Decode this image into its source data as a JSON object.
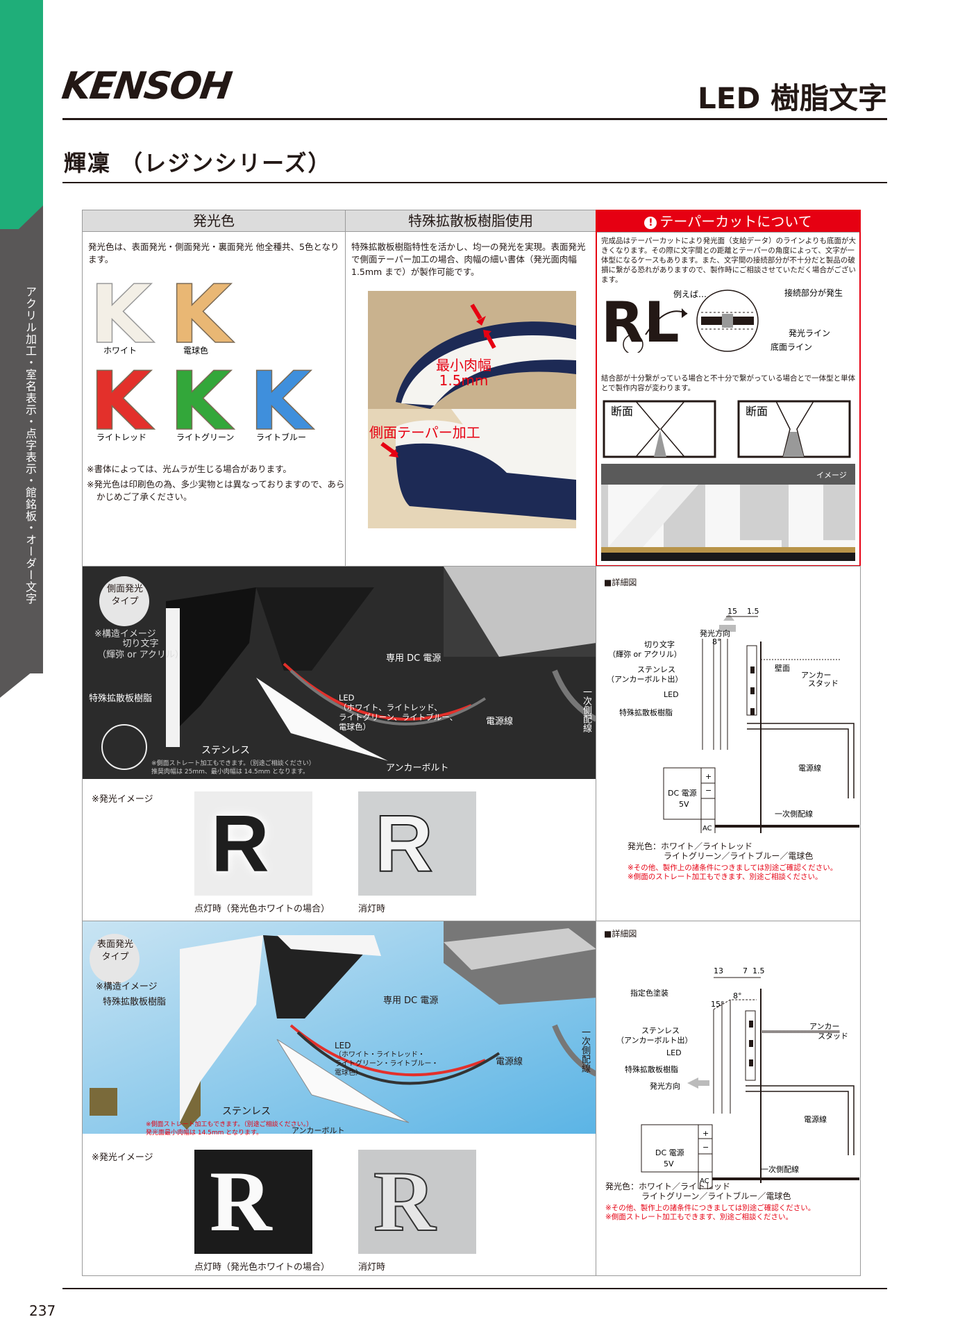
{
  "brand": "KENSOH",
  "doc_title": "LED 樹脂文字",
  "series_title": "輝凜 （レジンシリーズ）",
  "side_label": "アクリル加工・室名表示・点字表示・館銘板・オーダー文字",
  "page_number": "237",
  "color_section": {
    "header": "発光色",
    "desc": "発光色は、表面発光・側面発光・裏面発光 他全種共、5色となります。",
    "swatches": [
      {
        "label": "ホワイト",
        "color": "#f3efe6"
      },
      {
        "label": "電球色",
        "color": "#e9b774"
      },
      {
        "label": "ライトレッド",
        "color": "#e3302b"
      },
      {
        "label": "ライトグリーン",
        "color": "#33a73a"
      },
      {
        "label": "ライトブルー",
        "color": "#3f8fdc"
      }
    ],
    "letter": "K",
    "notes": [
      "※書体によっては、光ムラが生じる場合があります。",
      "※発光色は印刷色の為、多少実物とは異なっておりますので、あらかじめご了承ください。"
    ]
  },
  "diffuser_section": {
    "header": "特殊拡散板樹脂使用",
    "desc": "特殊拡散板樹脂特性を活かし、均一の発光を実現。表面発光で側面テーパー加工の場合、肉幅の細い書体（発光面肉幅 1.5mm まで）が製作可能です。",
    "min_width_label": "最小肉幅",
    "min_width_value": "1.5mm",
    "taper_label": "側面テーパー加工"
  },
  "taper_section": {
    "header": "テーパーカットについて",
    "desc": "完成品はテーパーカットにより発光面（支給データ）のラインよりも底面が大きくなります。その際に文字間との距離とテーパーの角度によって、文字が一体型になるケースもあります。また、文字間の接続部分が不十分だと製品の破損に繋がる恐れがありますので、製作時にご相談させていただく場合がございます。",
    "example": "例えば…",
    "sample": "RL",
    "joint": "接続部分が発生",
    "emit_line": "発光ライン",
    "bottom_line": "底面ライン",
    "joint_note": "結合部が十分繋がっている場合と不十分で繋がっている場合とで一体型と単体とで製作内容が変わります。",
    "section_label": "断面",
    "image_label": "イメージ"
  },
  "side_type": {
    "badge": [
      "側面発光",
      "タイプ"
    ],
    "structure": "※構造イメージ",
    "cut_letter": [
      "切り文字",
      "（輝弥 or アクリル）"
    ],
    "diffuser": "特殊拡散板樹脂",
    "dc": "専用 DC 電源",
    "led": [
      "LED",
      "（ホワイト、ライトレッド、",
      "ライトグリーン、ライトブルー、",
      "電球色）"
    ],
    "wire": "電源線",
    "primary": "一次側配線",
    "stainless": "ステンレス",
    "anchor": "アンカーボルト",
    "straight_note": [
      "※側面ストレート加工もできます。（別途ご相談ください）",
      "推奨肉幅は 25mm、最小肉幅は 14.5mm となります。"
    ],
    "glow_title": "※発光イメージ",
    "glow_letter": "R",
    "lit": "点灯時（発光色ホワイトの場合）",
    "off": "消灯時",
    "detail": {
      "title": "■詳細図",
      "dims": [
        "15",
        "1.5"
      ],
      "direction": "発光方向",
      "angle": "8°",
      "cut_letter": [
        "切り文字",
        "（輝弥 or アクリル）"
      ],
      "stainless": [
        "ステンレス",
        "（アンカーボルト出）"
      ],
      "led": "LED",
      "diffuser": "特殊拡散板樹脂",
      "wall": "壁面",
      "anchor": [
        "アンカー",
        "スタッド"
      ],
      "wire": "電源線",
      "dc": [
        "DC 電源",
        "5V"
      ],
      "plus": "+",
      "minus": "−",
      "ac": "AC",
      "primary": "一次側配線",
      "colors": [
        "発光色：ホワイト／ライトレッド",
        "ライトグリーン／ライトブルー／電球色"
      ],
      "notes": [
        "※その他、製作上の諸条件につきましては別途ご確認ください。",
        "※側面のストレート加工もできます、別途ご相談ください。"
      ]
    }
  },
  "face_type": {
    "badge": [
      "表面発光",
      "タイプ"
    ],
    "structure": "※構造イメージ",
    "diffuser": "特殊拡散板樹脂",
    "dc": "専用 DC 電源",
    "led": [
      "LED",
      "（ホワイト・ライトレッド・",
      "ライトグリーン・ライトブルー・",
      "電球色）"
    ],
    "wire": "電源線",
    "primary": "一次側配線",
    "stainless": "ステンレス",
    "anchor": "アンカーボルト",
    "straight_note": [
      "※側面ストレート加工もできます。（別途ご相談ください。）",
      "発光面最小肉幅は 14.5mm となります。"
    ],
    "glow_title": "※発光イメージ",
    "glow_letter": "R",
    "lit": "点灯時（発光色ホワイトの場合）",
    "off": "消灯時",
    "detail": {
      "title": "■詳細図",
      "dims": [
        "13",
        "7",
        "1.5"
      ],
      "paint": "指定色塗装",
      "angles": [
        "15°",
        "8°"
      ],
      "stainless": [
        "ステンレス",
        "（アンカーボルト出）"
      ],
      "led": "LED",
      "diffuser": "特殊拡散板樹脂",
      "direction": "発光方向",
      "anchor": [
        "アンカー",
        "スタッド"
      ],
      "wire": "電源線",
      "dc": [
        "DC 電源",
        "5V"
      ],
      "plus": "+",
      "minus": "−",
      "ac": "AC",
      "primary": "一次側配線",
      "colors": [
        "発光色：ホワイト／ライトレッド",
        "ライトグリーン／ライトブルー／電球色"
      ],
      "notes": [
        "※その他、製作上の諸条件につきましては別途ご確認ください。",
        "※側面ストレート加工もできます、別途ご相談ください。"
      ]
    }
  }
}
